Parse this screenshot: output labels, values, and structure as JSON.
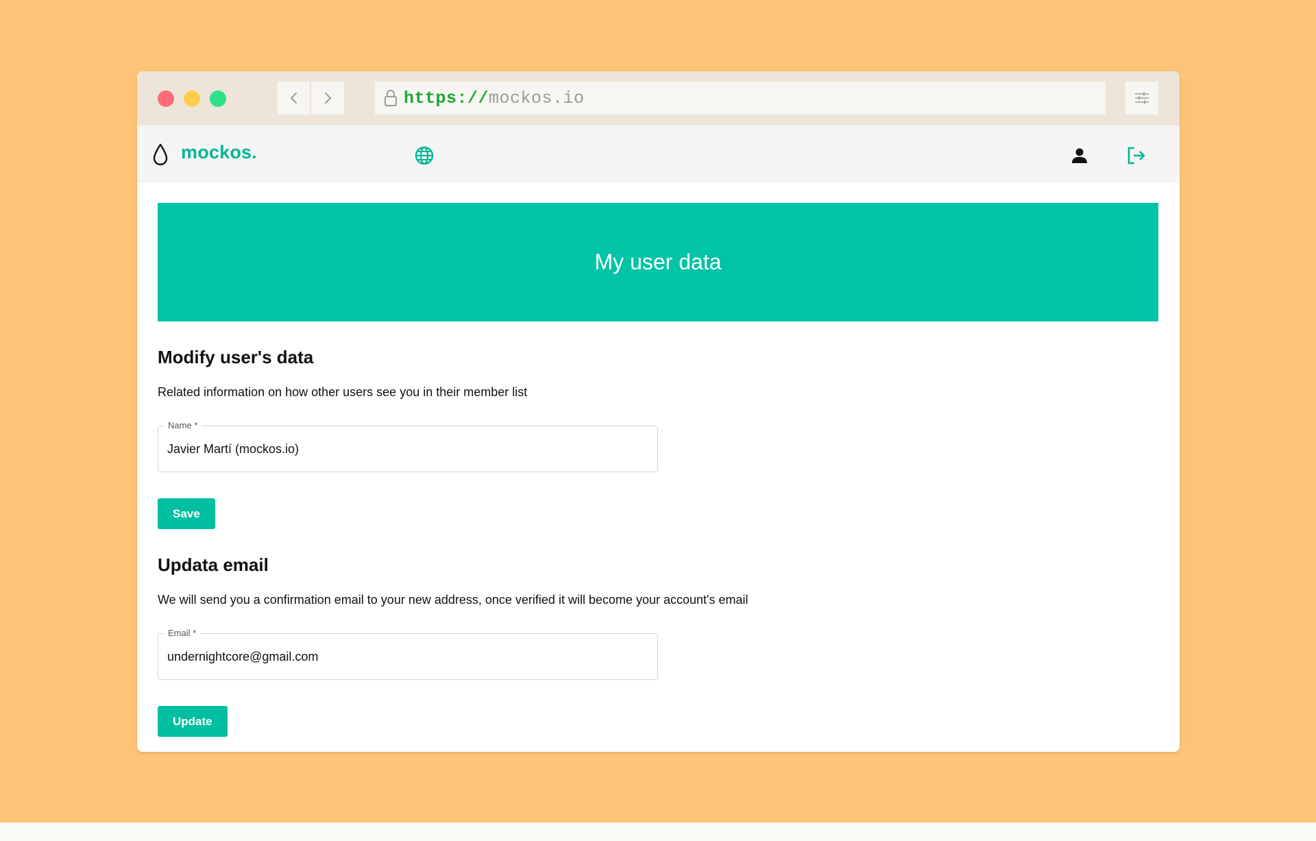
{
  "browser": {
    "url_scheme": "https://",
    "url_host": "mockos.io"
  },
  "header": {
    "logo_text": "mockos.",
    "brand_color": "#00B796",
    "icons": {
      "logo": "water-drop-icon",
      "language": "globe-icon",
      "profile": "user-icon",
      "logout": "logout-icon"
    }
  },
  "banner": {
    "title": "My user data",
    "color": "#01C3A6"
  },
  "user_section": {
    "title": "Modify user's data",
    "description": "Related information on how other users see you in their member list",
    "name_field": {
      "label": "Name *",
      "value": "Javier Martí (mockos.io)"
    },
    "save_label": "Save"
  },
  "email_section": {
    "title": "Updata email",
    "description": "We will send you a confirmation email to your new address, once verified it will become your account's email",
    "email_field": {
      "label": "Email *",
      "value": "undernightcore@gmail.com"
    },
    "update_label": "Update"
  }
}
